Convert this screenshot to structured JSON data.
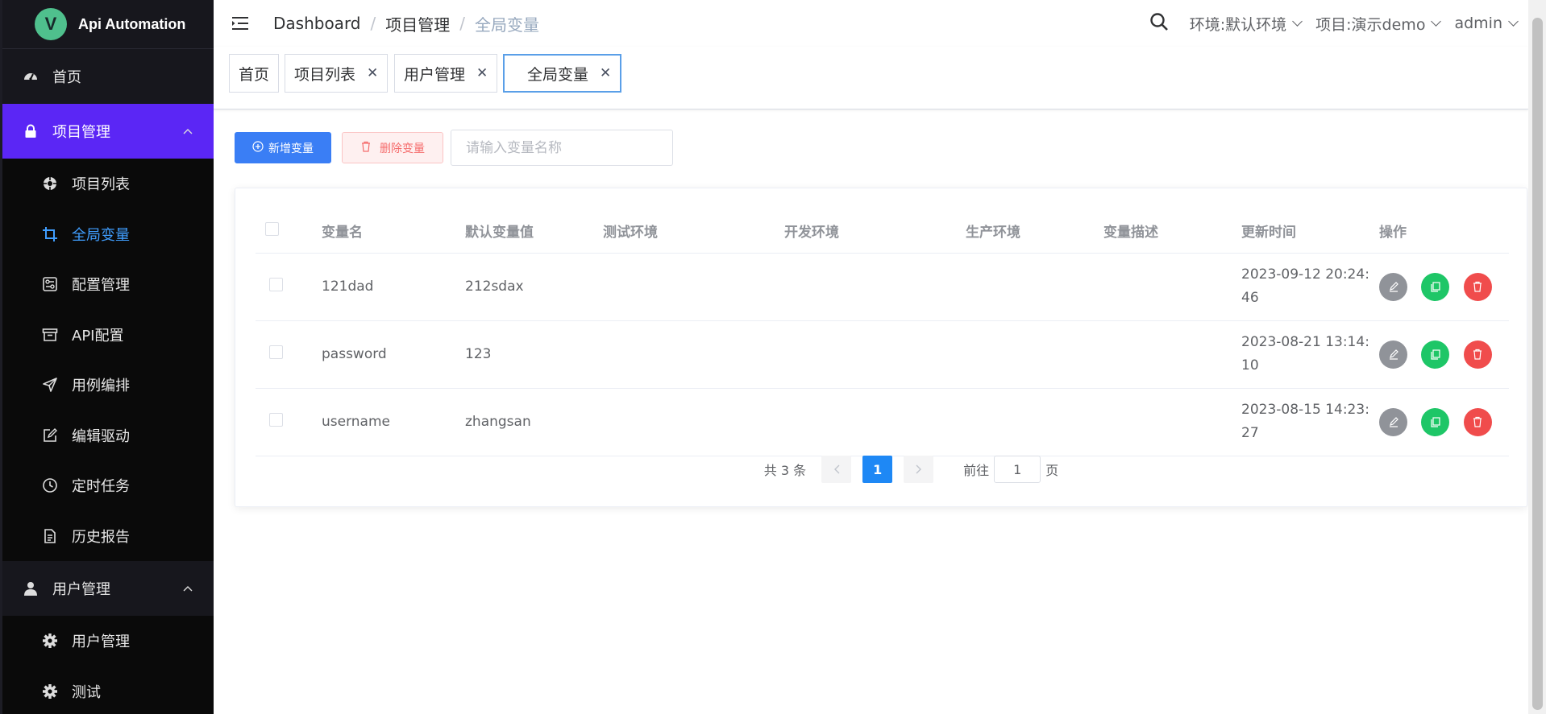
{
  "app": {
    "logo_letter": "V",
    "title": "Api Automation"
  },
  "sidebar": {
    "items": [
      {
        "label": "首页",
        "icon": "dashboard-icon"
      },
      {
        "label": "项目管理",
        "icon": "lock-icon",
        "active": true,
        "expanded": true
      },
      {
        "label": "项目列表",
        "icon": "circle-icon"
      },
      {
        "label": "全局变量",
        "icon": "crop-icon",
        "active": true
      },
      {
        "label": "配置管理",
        "icon": "setting-icon"
      },
      {
        "label": "API配置",
        "icon": "archive-icon"
      },
      {
        "label": "用例编排",
        "icon": "send-icon"
      },
      {
        "label": "编辑驱动",
        "icon": "edit-icon"
      },
      {
        "label": "定时任务",
        "icon": "clock-icon"
      },
      {
        "label": "历史报告",
        "icon": "document-icon"
      },
      {
        "label": "用户管理",
        "icon": "user-icon",
        "expanded": true
      },
      {
        "label": "用户管理",
        "icon": "gear-icon"
      },
      {
        "label": "测试",
        "icon": "gear-icon"
      }
    ]
  },
  "header": {
    "breadcrumb": [
      "Dashboard",
      "项目管理",
      "全局变量"
    ],
    "env": "环境:默认环境",
    "project": "项目:演示demo",
    "user": "admin"
  },
  "tags": [
    {
      "label": "首页"
    },
    {
      "label": "项目列表",
      "closable": true
    },
    {
      "label": "用户管理",
      "closable": true
    },
    {
      "label": "全局变量",
      "closable": true,
      "active": true
    }
  ],
  "toolbar": {
    "add_label": "新增变量",
    "delete_label": "删除变量",
    "search_placeholder": "请输入变量名称"
  },
  "table": {
    "columns": [
      "变量名",
      "默认变量值",
      "测试环境",
      "开发环境",
      "生产环境",
      "变量描述",
      "更新时间",
      "操作"
    ],
    "rows": [
      {
        "name": "121dad",
        "value": "212sdax",
        "test": "",
        "dev": "",
        "prod": "",
        "desc": "",
        "time_1": "2023-09-12 20:24:",
        "time_2": "46"
      },
      {
        "name": "password",
        "value": "123",
        "test": "",
        "dev": "",
        "prod": "",
        "desc": "",
        "time_1": "2023-08-21 13:14:",
        "time_2": "10"
      },
      {
        "name": "username",
        "value": "zhangsan",
        "test": "",
        "dev": "",
        "prod": "",
        "desc": "",
        "time_1": "2023-08-15 14:23:",
        "time_2": "27"
      }
    ]
  },
  "pagination": {
    "total": "共 3 条",
    "current": "1",
    "goto_label": "前往",
    "goto_value": "1",
    "page_suffix": "页"
  },
  "colors": {
    "sidebar_bg": "#0d0d0f",
    "active_menu": "#5b26f5",
    "primary": "#3a7ef5",
    "danger": "#f04c4c",
    "success": "#1ec667",
    "active_link": "#409eff"
  }
}
